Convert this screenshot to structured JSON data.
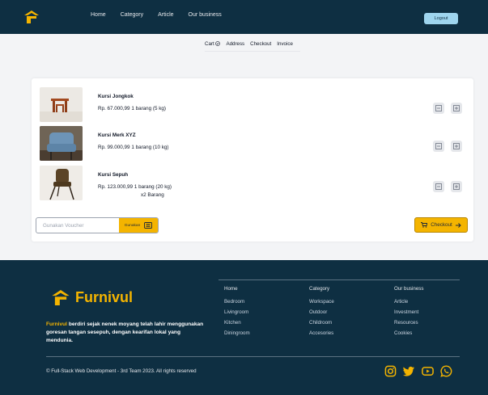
{
  "header": {
    "nav": [
      "Home",
      "Category",
      "Article",
      "Our business"
    ],
    "logout_label": "Logout"
  },
  "tabs": [
    "Cart",
    "Address",
    "Checkout",
    "Invoice"
  ],
  "cart": {
    "items": [
      {
        "name": "Kursi Jongkok",
        "price": "Rp. 67.000,99",
        "detail": "1 barang (5 kg)",
        "qty": ""
      },
      {
        "name": "Kursi Merk XYZ",
        "price": "Rp. 99.000,99",
        "detail": "1 barang (10 kg)",
        "qty": ""
      },
      {
        "name": "Kursi Sepuh",
        "price": "Rp. 123.000,99",
        "detail": "1 barang (20 kg)",
        "qty": "x2 Barang"
      }
    ],
    "voucher_placeholder": "Gunakan Voucher",
    "voucher_button": "Gunakan",
    "checkout_label": "Checkout"
  },
  "footer": {
    "brand": "Furnivul",
    "desc_highlight": "Furnivul",
    "desc_rest": " berdiri sejak nenek moyang telah lahir menggunakan goresan tangan sesepuh, dengan kearifan lokal yang mendunia.",
    "col1": {
      "head": "Home",
      "links": [
        "Bedroom",
        "Livingroom",
        "Kitchen",
        "Diningroom"
      ]
    },
    "col2": {
      "head": "Category",
      "links": [
        "Workspace",
        "Outdoor",
        "Childroom",
        "Accesories"
      ]
    },
    "col3": {
      "head": "Our business",
      "links": [
        "Article",
        "Investment",
        "Resources",
        "Cookies"
      ]
    },
    "copyright": "© Full-Stack Web Development - 3rd Team 2023. All rights reserved",
    "socials": [
      "instagram-icon",
      "twitter-icon",
      "youtube-icon",
      "whatsapp-icon"
    ]
  },
  "colors": {
    "navy": "#0e2f42",
    "accent": "#f4b400",
    "logout": "#9ed5ee"
  }
}
